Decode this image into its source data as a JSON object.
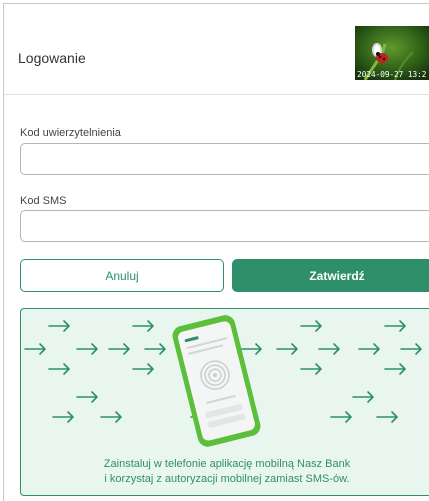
{
  "header": {
    "title": "Logowanie",
    "captcha_timestamp": "2024-09-27 13:2"
  },
  "form": {
    "auth_code": {
      "label": "Kod uwierzytelnienia",
      "value": "",
      "placeholder": ""
    },
    "sms_code": {
      "label": "Kod SMS",
      "value": "",
      "placeholder": ""
    }
  },
  "buttons": {
    "cancel_label": "Anuluj",
    "confirm_label": "Zatwierdź"
  },
  "promo": {
    "line1": "Zainstaluj w telefonie aplikację mobilną Nasz Bank",
    "line2": "i korzystaj z autoryzacji mobilnej zamiast SMS-ów.",
    "icon": "phone-fingerprint-icon"
  },
  "colors": {
    "accent": "#2f8f6a",
    "promo_bg": "#e9f6f0",
    "border": "#b5b5b5"
  }
}
